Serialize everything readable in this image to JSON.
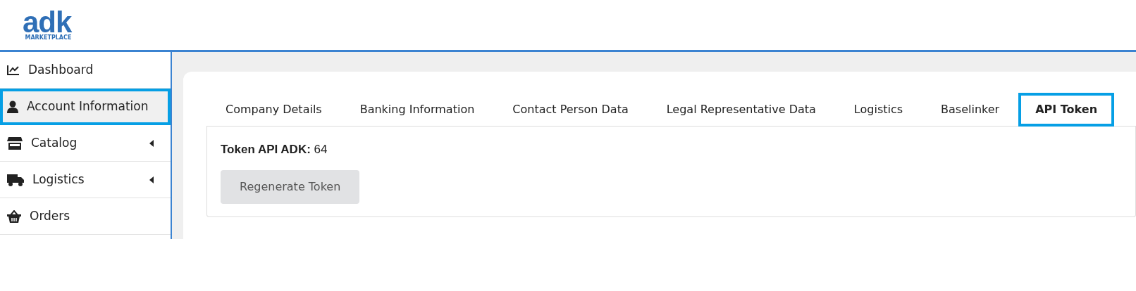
{
  "logo": {
    "name": "adk",
    "tagline": "MARKETPLACE"
  },
  "sidebar": {
    "items": [
      {
        "label": "Dashboard",
        "selected": false,
        "expandable": false
      },
      {
        "label": "Account Information",
        "selected": true,
        "expandable": false
      },
      {
        "label": "Catalog",
        "selected": false,
        "expandable": true
      },
      {
        "label": "Logistics",
        "selected": false,
        "expandable": true
      },
      {
        "label": "Orders",
        "selected": false,
        "expandable": false
      }
    ]
  },
  "tabs": [
    {
      "label": "Company Details",
      "selected": false
    },
    {
      "label": "Banking Information",
      "selected": false
    },
    {
      "label": "Contact Person Data",
      "selected": false
    },
    {
      "label": "Legal Representative Data",
      "selected": false
    },
    {
      "label": "Logistics",
      "selected": false
    },
    {
      "label": "Baselinker",
      "selected": false
    },
    {
      "label": "API Token",
      "selected": true
    }
  ],
  "token": {
    "label": "Token API ADK:",
    "value": "64"
  },
  "buttons": [
    {
      "label": "Regenerate Token",
      "disabled": true
    }
  ]
}
